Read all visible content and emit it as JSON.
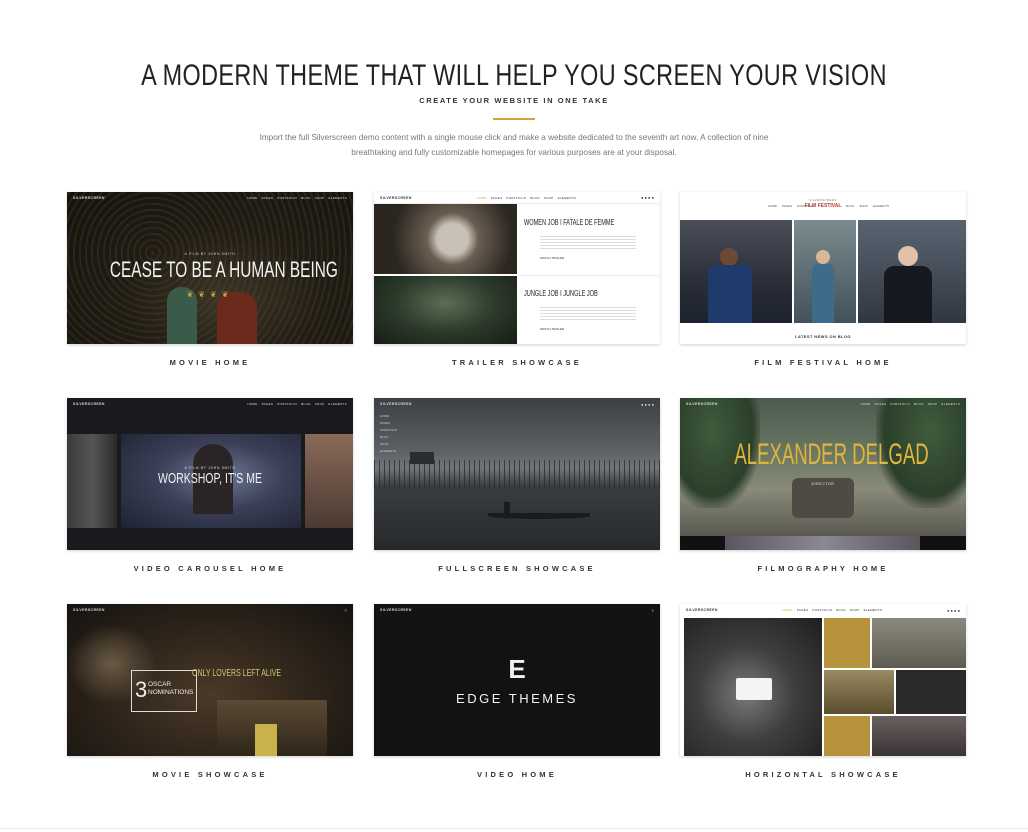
{
  "header": {
    "title": "A MODERN THEME THAT WILL HELP YOU SCREEN YOUR VISION",
    "subtitle": "CREATE YOUR WEBSITE IN ONE TAKE",
    "description": "Import the full Silverscreen demo content with a single mouse click and make a website dedicated to the seventh art now. A collection of nine breathtaking and fully customizable homepages for various purposes are at your disposal.",
    "accent_color": "#d4a437"
  },
  "demos": [
    {
      "label": "MOVIE HOME",
      "headline": "CEASE TO BE A HUMAN BEING",
      "kicker": "A FILM BY JOHN SMITH"
    },
    {
      "label": "TRAILER SHOWCASE",
      "heading_1": "WOMEN JOB I FATALE DE FEMME",
      "heading_2": "JUNGLE JOB I JUNGLE JOB",
      "link": "WATCH TRAILER"
    },
    {
      "label": "FILM FESTIVAL HOME",
      "logo_top": "SILVERSCREEN",
      "logo": "FILM FESTIVAL",
      "footer_text": "LATEST NEWS ON BLOG"
    },
    {
      "label": "VIDEO CAROUSEL HOME",
      "headline": "WORKSHOP, IT'S ME",
      "kicker": "A FILM BY JOHN SMITH"
    },
    {
      "label": "FULLSCREEN SHOWCASE"
    },
    {
      "label": "FILMOGRAPHY HOME",
      "headline": "ALEXANDER DELGAD",
      "kicker": "DIRECTOR"
    },
    {
      "label": "MOVIE SHOWCASE",
      "number": "3",
      "badge": "OSCAR NOMINATIONS",
      "headline": "ONLY LOVERS LEFT ALIVE"
    },
    {
      "label": "VIDEO HOME",
      "logo_mark": "E",
      "brand": "EDGE THEMES"
    },
    {
      "label": "HORIZONTAL SHOWCASE"
    }
  ],
  "mini_site": {
    "logo": "SILVERSCREEN",
    "menu": [
      "HOME",
      "PAGES",
      "PORTFOLIO",
      "BLOG",
      "SHOP",
      "ELEMENTS"
    ]
  }
}
